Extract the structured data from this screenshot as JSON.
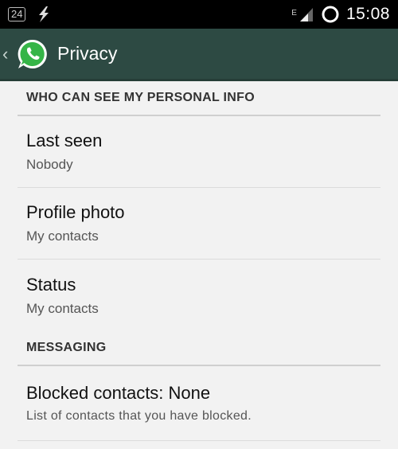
{
  "status_bar": {
    "badge": "24",
    "network_type": "E",
    "time": "15:08",
    "icons": [
      "notification-24-icon",
      "flash-icon",
      "signal-icon",
      "sync-ring-icon"
    ]
  },
  "action_bar": {
    "title": "Privacy",
    "back_icon": "chevron-left-icon",
    "logo_icon": "whatsapp-logo-icon",
    "color": "#2d4a43"
  },
  "sections": {
    "personal_info": {
      "header": "WHO CAN SEE MY PERSONAL INFO",
      "items": [
        {
          "title": "Last seen",
          "summary": "Nobody"
        },
        {
          "title": "Profile photo",
          "summary": "My contacts"
        },
        {
          "title": "Status",
          "summary": "My contacts"
        }
      ]
    },
    "messaging": {
      "header": "MESSAGING",
      "items": [
        {
          "title": "Blocked contacts: None",
          "summary": "List of contacts that you have blocked."
        }
      ]
    }
  }
}
